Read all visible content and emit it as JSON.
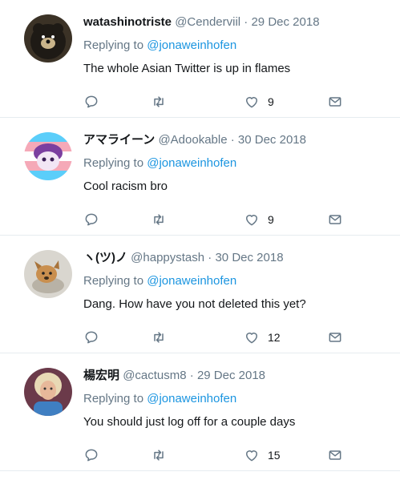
{
  "tweets": [
    {
      "name": "watashinotriste",
      "handle": "@Cenderviil",
      "sep": "·",
      "date": "29 Dec 2018",
      "replying_prefix": "Replying to",
      "replying_to": "@jonaweinhofen",
      "text": "The whole Asian Twitter is up in flames",
      "like_count": "9",
      "avatar_icon": "bear-avatar"
    },
    {
      "name": "アマライーン",
      "handle": "@Adookable",
      "sep": "·",
      "date": "30 Dec 2018",
      "replying_prefix": "Replying to",
      "replying_to": "@jonaweinhofen",
      "text": "Cool racism bro",
      "like_count": "9",
      "avatar_icon": "cartoon-avatar"
    },
    {
      "name": "ヽ(ツ)ノ",
      "handle": "@happystash",
      "sep": "·",
      "date": "30 Dec 2018",
      "replying_prefix": "Replying to",
      "replying_to": "@jonaweinhofen",
      "text": "Dang. How have you not deleted this yet?",
      "like_count": "12",
      "avatar_icon": "dog-avatar"
    },
    {
      "name": "楊宏明",
      "handle": "@cactusm8",
      "sep": "·",
      "date": "29 Dec 2018",
      "replying_prefix": "Replying to",
      "replying_to": "@jonaweinhofen",
      "text": "You should just log off for a couple days",
      "like_count": "15",
      "avatar_icon": "person-avatar"
    }
  ],
  "colors": {
    "link": "#1b95e0",
    "muted": "#657786",
    "divider": "#e6ecf0"
  }
}
